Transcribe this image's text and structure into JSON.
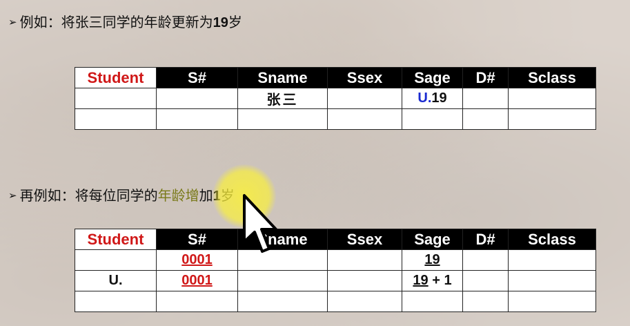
{
  "bullets": [
    {
      "arrow": "➢",
      "text": "例如：将张三同学的年龄更新为",
      "bold": "19",
      "suffix": "岁"
    },
    {
      "arrow": "➢",
      "text_a": "再例如：将每位同学的",
      "text_hl": "年龄增",
      "text_b": "加",
      "bold": "1",
      "suffix": "岁"
    }
  ],
  "table1": {
    "relation": "Student",
    "columns": [
      "S#",
      "Sname",
      "Ssex",
      "Sage",
      "D#",
      "Sclass"
    ],
    "row1": {
      "c0": "",
      "s": "",
      "sname": "张三",
      "ssex": "",
      "sage_prefix": "U.",
      "sage_value": "19",
      "d": "",
      "sclass": ""
    }
  },
  "table2": {
    "relation": "Student",
    "columns": [
      "S#",
      "Sname",
      "Ssex",
      "Sage",
      "D#",
      "Sclass"
    ],
    "row1": {
      "c0": "",
      "s": "0001",
      "sage": "19"
    },
    "row2": {
      "c0": "U.",
      "s": "0001",
      "sage_a": "19",
      "sage_b": " + 1"
    }
  },
  "colors": {
    "relation_name": "#d01818",
    "header_bg": "#000000",
    "update_prefix": "#1a2ad0",
    "example_element": "#d01818"
  },
  "overlays": {
    "highlighter": "yellow-highlight-circle",
    "pointer": "arrow-cursor-icon"
  }
}
